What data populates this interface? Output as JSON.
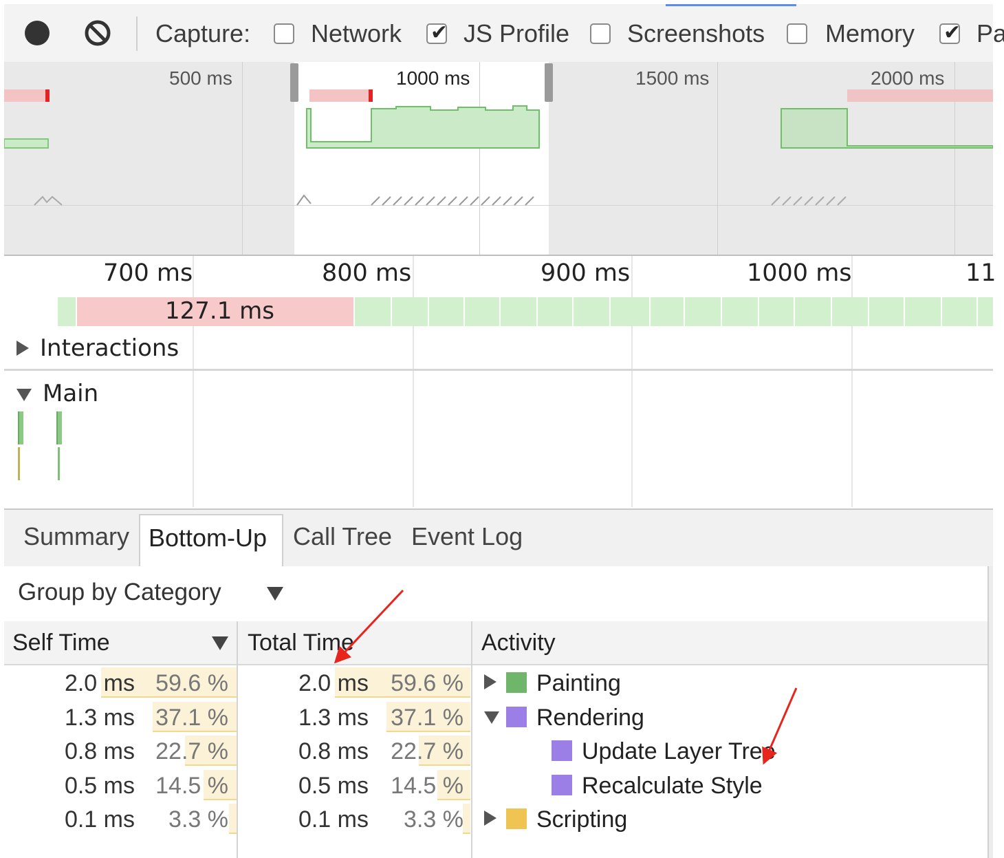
{
  "toolbar": {
    "capture_label": "Capture:",
    "options": [
      {
        "label": "Network",
        "checked": false
      },
      {
        "label": "JS Profile",
        "checked": true
      },
      {
        "label": "Screenshots",
        "checked": false
      },
      {
        "label": "Memory",
        "checked": false
      },
      {
        "label": "Pa",
        "checked": true
      }
    ]
  },
  "overview": {
    "ticks": [
      "500 ms",
      "1000 ms",
      "1500 ms",
      "2000 ms"
    ]
  },
  "timeline": {
    "ticks": [
      "700 ms",
      "800 ms",
      "900 ms",
      "1000 ms",
      "11"
    ],
    "long_frame_label": "127.1 ms",
    "tracks": {
      "interactions": "Interactions",
      "main": "Main"
    }
  },
  "tabs": [
    {
      "label": "Summary",
      "active": false
    },
    {
      "label": "Bottom-Up",
      "active": true
    },
    {
      "label": "Call Tree",
      "active": false
    },
    {
      "label": "Event Log",
      "active": false
    }
  ],
  "grouping": {
    "selected": "Group by Category"
  },
  "table": {
    "headers": {
      "self_time": "Self Time",
      "total_time": "Total Time",
      "activity": "Activity"
    },
    "rows": [
      {
        "self_time": "2.0 ms",
        "self_pct": "59.6 %",
        "total_time": "2.0 ms",
        "total_pct": "59.6 %",
        "pct_value": 59.6,
        "activity": "Painting",
        "color": "#6fb56a",
        "expander": "collapsed",
        "indent": 0
      },
      {
        "self_time": "1.3 ms",
        "self_pct": "37.1 %",
        "total_time": "1.3 ms",
        "total_pct": "37.1 %",
        "pct_value": 37.1,
        "activity": "Rendering",
        "color": "#9b7fe6",
        "expander": "expanded",
        "indent": 0
      },
      {
        "self_time": "0.8 ms",
        "self_pct": "22.7 %",
        "total_time": "0.8 ms",
        "total_pct": "22.7 %",
        "pct_value": 22.7,
        "activity": "Update Layer Tree",
        "color": "#9b7fe6",
        "expander": "none",
        "indent": 1
      },
      {
        "self_time": "0.5 ms",
        "self_pct": "14.5 %",
        "total_time": "0.5 ms",
        "total_pct": "14.5 %",
        "pct_value": 14.5,
        "activity": "Recalculate Style",
        "color": "#9b7fe6",
        "expander": "none",
        "indent": 1
      },
      {
        "self_time": "0.1 ms",
        "self_pct": "3.3 %",
        "total_time": "0.1 ms",
        "total_pct": "3.3 %",
        "pct_value": 3.3,
        "activity": "Scripting",
        "color": "#f0c453",
        "expander": "collapsed",
        "indent": 0
      }
    ]
  },
  "colors": {
    "frame_long": "#f7c9c9",
    "frame_ok": "#d2f0ce",
    "annotation_arrow": "#e8251c"
  }
}
